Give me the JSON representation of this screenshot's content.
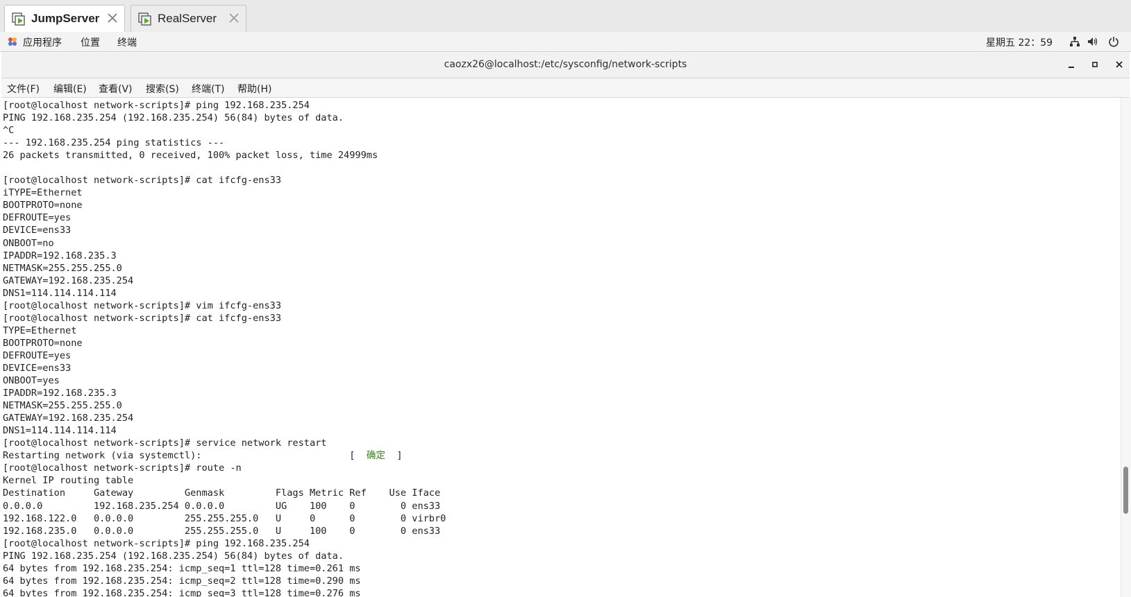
{
  "tabs": [
    {
      "label": "JumpServer",
      "active": true,
      "icon": "vm-icon"
    },
    {
      "label": "RealServer",
      "active": false,
      "icon": "vm-icon"
    }
  ],
  "topbar": {
    "menus": [
      "应用程序",
      "位置",
      "终端"
    ],
    "clock": "星期五 22：59",
    "tray_icons": [
      "network-icon",
      "volume-icon",
      "power-icon"
    ]
  },
  "window": {
    "title": "caozx26@localhost:/etc/sysconfig/network-scripts",
    "controls": [
      "minimize",
      "maximize",
      "close"
    ]
  },
  "menubar": [
    "文件(F)",
    "编辑(E)",
    "查看(V)",
    "搜索(S)",
    "终端(T)",
    "帮助(H)"
  ],
  "terminal": {
    "lines": [
      "[root@localhost network-scripts]# ping 192.168.235.254",
      "PING 192.168.235.254 (192.168.235.254) 56(84) bytes of data.",
      "^C",
      "--- 192.168.235.254 ping statistics ---",
      "26 packets transmitted, 0 received, 100% packet loss, time 24999ms",
      "",
      "[root@localhost network-scripts]# cat ifcfg-ens33",
      "iTYPE=Ethernet",
      "BOOTPROTO=none",
      "DEFROUTE=yes",
      "DEVICE=ens33",
      "ONBOOT=no",
      "IPADDR=192.168.235.3",
      "NETMASK=255.255.255.0",
      "GATEWAY=192.168.235.254",
      "DNS1=114.114.114.114",
      "[root@localhost network-scripts]# vim ifcfg-ens33",
      "[root@localhost network-scripts]# cat ifcfg-ens33",
      "TYPE=Ethernet",
      "BOOTPROTO=none",
      "DEFROUTE=yes",
      "DEVICE=ens33",
      "ONBOOT=yes",
      "IPADDR=192.168.235.3",
      "NETMASK=255.255.255.0",
      "GATEWAY=192.168.235.254",
      "DNS1=114.114.114.114",
      "[root@localhost network-scripts]# service network restart",
      "Restarting network (via systemctl):                          [ ",
      "[root@localhost network-scripts]# route -n",
      "Kernel IP routing table",
      "Destination     Gateway         Genmask         Flags Metric Ref    Use Iface",
      "0.0.0.0         192.168.235.254 0.0.0.0         UG    100    0        0 ens33",
      "192.168.122.0   0.0.0.0         255.255.255.0   U     0      0        0 virbr0",
      "192.168.235.0   0.0.0.0         255.255.255.0   U     100    0        0 ens33",
      "[root@localhost network-scripts]# ping 192.168.235.254",
      "PING 192.168.235.254 (192.168.235.254) 56(84) bytes of data.",
      "64 bytes from 192.168.235.254: icmp_seq=1 ttl=128 time=0.261 ms",
      "64 bytes from 192.168.235.254: icmp_seq=2 ttl=128 time=0.290 ms",
      "64 bytes from 192.168.235.254: icmp_seq=3 ttl=128 time=0.276 ms"
    ],
    "status_line_index": 28,
    "status_ok": "确定",
    "status_suffix": " ]",
    "ok_color": "#2f8a12",
    "text_color": "#222222",
    "background": "#ffffff"
  }
}
